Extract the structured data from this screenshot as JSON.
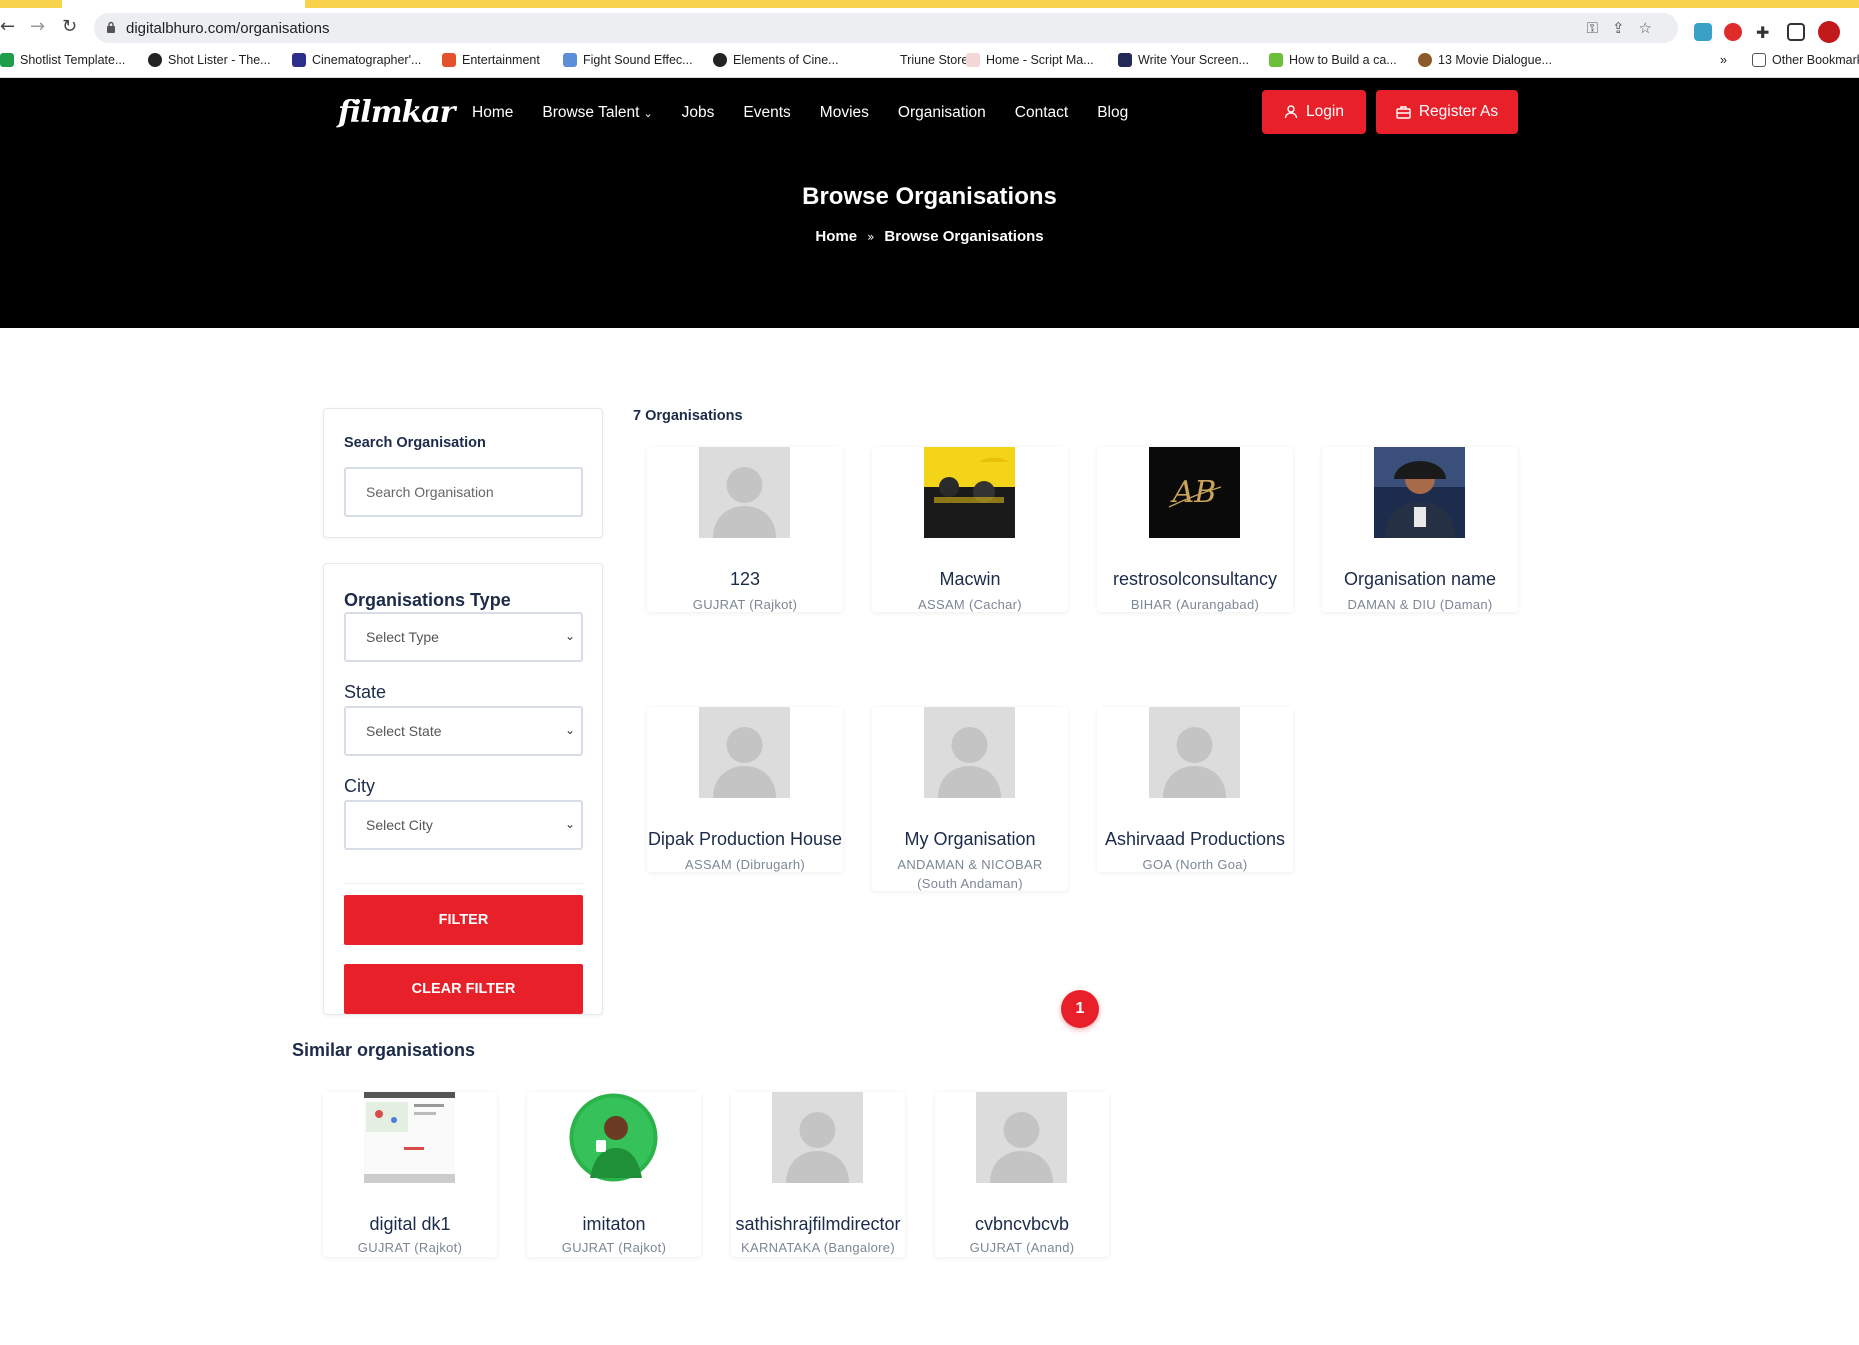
{
  "browser": {
    "url": "digitalbhuro.com/organisations",
    "bookmarks": [
      "Shotlist Template...",
      "Shot Lister - The...",
      "Cinematographer'...",
      "Entertainment",
      "Fight Sound Effec...",
      "Elements of Cine...",
      "Triune Store",
      "Home - Script Ma...",
      "Write Your Screen...",
      "How to Build a ca...",
      "13 Movie Dialogue..."
    ],
    "more_bookmarks": "»",
    "other_bookmarks": "Other Bookmarks"
  },
  "site": {
    "logo": "filmkar",
    "nav": [
      "Home",
      "Browse Talent",
      "Jobs",
      "Events",
      "Movies",
      "Organisation",
      "Contact",
      "Blog"
    ],
    "login": "Login",
    "register": "Register As",
    "hero_title": "Browse Organisations",
    "breadcrumb": [
      "Home",
      "Browse Organisations"
    ]
  },
  "sidebar": {
    "search_label": "Search Organisation",
    "search_placeholder": "Search Organisation",
    "type_label": "Organisations Type",
    "type_value": "Select Type",
    "state_label": "State",
    "state_value": "Select State",
    "city_label": "City",
    "city_value": "Select City",
    "filter_button": "FILTER",
    "clear_button": "CLEAR FILTER"
  },
  "results": {
    "count_label": "7 Organisations",
    "items": [
      {
        "name": "123",
        "location": "GUJRAT (Rajkot)",
        "image": "placeholder"
      },
      {
        "name": "Macwin",
        "location": "ASSAM (Cachar)",
        "image": "photo"
      },
      {
        "name": "restrosolconsultancy",
        "location": "BIHAR (Aurangabad)",
        "image": "logo"
      },
      {
        "name": "Organisation name",
        "location": "DAMAN & DIU (Daman)",
        "image": "photo"
      },
      {
        "name": "Dipak Production House",
        "location": "ASSAM (Dibrugarh)",
        "image": "placeholder"
      },
      {
        "name": "My Organisation",
        "location": "ANDAMAN & NICOBAR (South Andaman)",
        "image": "placeholder"
      },
      {
        "name": "Ashirvaad Productions",
        "location": "GOA (North Goa)",
        "image": "placeholder"
      }
    ],
    "page": "1"
  },
  "similar": {
    "title": "Similar organisations",
    "items": [
      {
        "name": "digital dk1",
        "location": "GUJRAT (Rajkot)",
        "image": "screenshot"
      },
      {
        "name": "imitaton",
        "location": "GUJRAT (Rajkot)",
        "image": "photo"
      },
      {
        "name": "sathishrajfilmdirector",
        "location": "KARNATAKA (Bangalore)",
        "image": "placeholder"
      },
      {
        "name": "cvbncvbcvb",
        "location": "GUJRAT (Anand)",
        "image": "placeholder"
      }
    ]
  },
  "colors": {
    "accent": "#e8202a",
    "header_bg": "#000000",
    "text": "#1c2b4a",
    "muted": "#7c8796"
  }
}
